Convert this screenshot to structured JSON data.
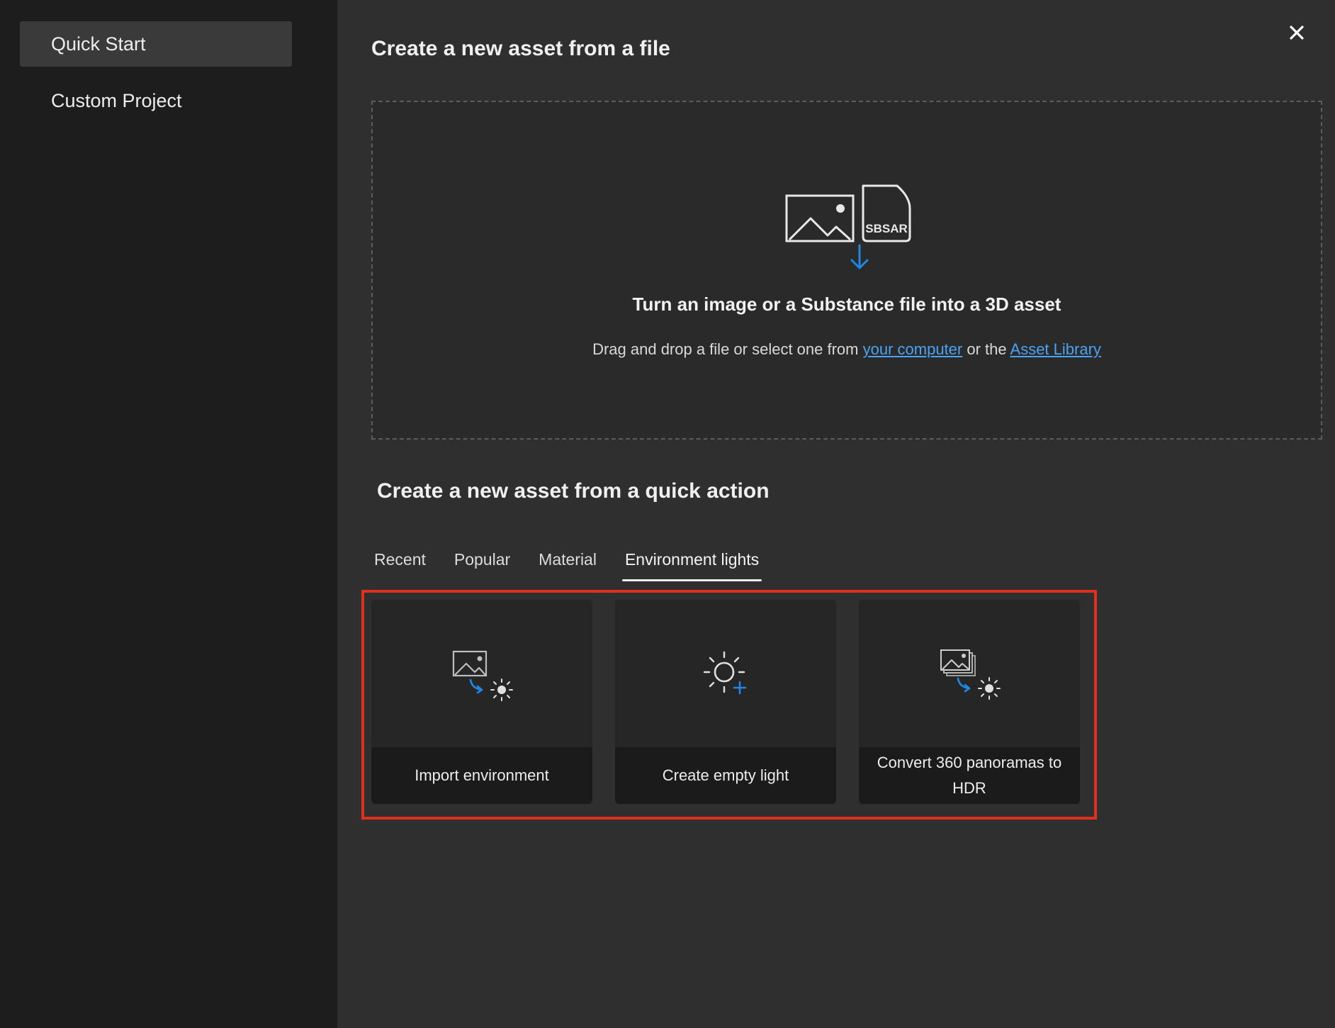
{
  "sidebar": {
    "items": [
      {
        "label": "Quick Start",
        "active": true
      },
      {
        "label": "Custom Project",
        "active": false
      }
    ]
  },
  "file_section": {
    "title": "Create a new asset from a file",
    "dropzone": {
      "badge": "SBSAR",
      "heading": "Turn an image or a Substance file into a 3D asset",
      "sub_prefix": "Drag and drop a file or select one from ",
      "link_computer": "your computer",
      "sub_middle": " or the ",
      "link_library": "Asset Library"
    }
  },
  "quick_section": {
    "title": "Create a new asset from a quick action",
    "tabs": [
      {
        "label": "Recent",
        "active": false
      },
      {
        "label": "Popular",
        "active": false
      },
      {
        "label": "Material",
        "active": false
      },
      {
        "label": "Environment lights",
        "active": true
      }
    ],
    "cards": [
      {
        "label": "Import environment",
        "icon": "import-environment-icon"
      },
      {
        "label": "Create empty light",
        "icon": "empty-light-icon"
      },
      {
        "label": "Convert 360 panoramas to HDR",
        "icon": "panorama-hdr-icon"
      }
    ]
  },
  "colors": {
    "accent_blue": "#1e88e5",
    "link_blue": "#4aa3f3",
    "highlight_red": "#e0301e"
  }
}
